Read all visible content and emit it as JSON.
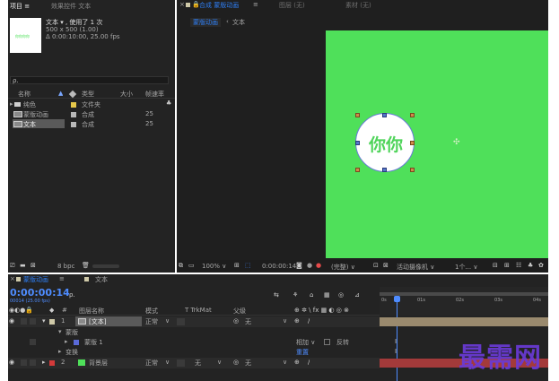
{
  "colors": {
    "panel_bg": "#232323",
    "comp_green": "#4fe05a",
    "accent_blue": "#2e7df2",
    "timecode_blue": "#4e8cff",
    "track_tan": "#9a8a6e",
    "track_red": "#a33a3a",
    "watermark_purple": "#6a3ad6"
  },
  "project": {
    "tab_project": "项目",
    "tab_effects": "效果控件 文本",
    "item_title": "文本 ▾ , 使用了 1 次",
    "item_size": "500 x 500 (1.00)",
    "item_duration": "Δ 0:00:10:00, 25.00 fps",
    "thumb_text": "你你你你",
    "search_placeholder": "ρ.",
    "columns": {
      "name": "名称",
      "type": "类型",
      "size": "大小",
      "fps": "帧速率"
    },
    "rows": [
      {
        "name": "纯色",
        "type": "文件夹",
        "fps": ""
      },
      {
        "name": "蒙版动画",
        "type": "合成",
        "fps": "25"
      },
      {
        "name": "文本",
        "type": "合成",
        "fps": "25"
      }
    ],
    "footer_bpc": "8 bpc"
  },
  "viewer": {
    "tab_comp": "合成 蒙版动画",
    "tab_layer": "图层 (无)",
    "tab_footage": "素材 (无)",
    "breadcrumb_1": "蒙版动画",
    "breadcrumb_2": "文本",
    "comp_text": "你你",
    "zoom": "100%",
    "timecode": "0:00:00:14",
    "quality": "(完整)",
    "camera": "活动摄像机",
    "views": "1个..."
  },
  "timeline": {
    "tab_comp": "蒙版动画",
    "tab_text": "文本",
    "timecode": "0:00:00:14",
    "frame_info": "00014 (25.00 fps)",
    "search_placeholder": "ρ.",
    "headers": {
      "num": "#",
      "layer_name": "图层名称",
      "mode": "模式",
      "trkmat": "T TrkMat",
      "parent": "父级"
    },
    "ruler": [
      "0s",
      "01s",
      "02s",
      "03s",
      "04s"
    ],
    "layers": [
      {
        "num": "1",
        "name": "[文本]",
        "mode": "正常",
        "parent": "无"
      },
      {
        "num": "2",
        "name": "背景层",
        "mode": "正常",
        "trkmat": "无",
        "parent": "无"
      }
    ],
    "mask_group": "蒙版",
    "mask_item": "蒙版 1",
    "mask_mode": "相加",
    "mask_invert": "反转",
    "transform": "变换",
    "reset": "重置",
    "watermark": "最需网"
  }
}
